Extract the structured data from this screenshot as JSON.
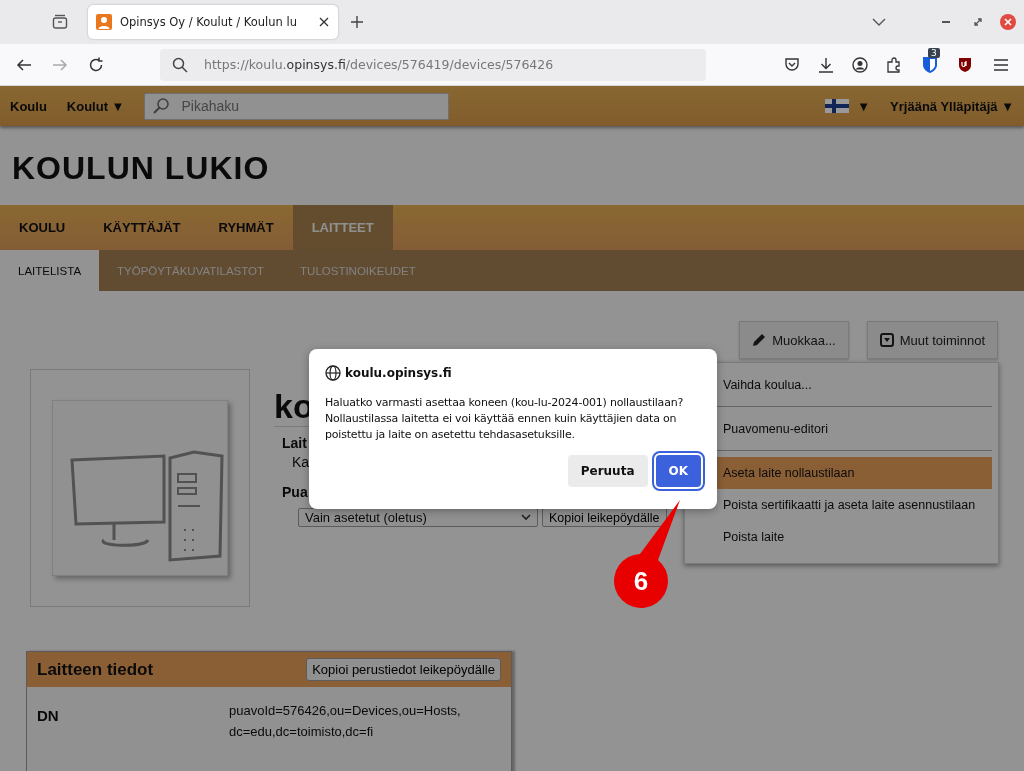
{
  "browser": {
    "tab_title": "Opinsys Oy / Koulut / Koulun lu",
    "url": "https://koulu.**opinsys.fi**/devices/576419/devices/576426",
    "extension_badge": "3"
  },
  "topbar": {
    "items": [
      "Koulu",
      "Koulut ▼"
    ],
    "search": {
      "placeholder": "Pikahaku"
    },
    "language_caret": "▼",
    "user": "Yrjäänä Ylläpitäjä ▼"
  },
  "school_title": "KOULUN LUKIO",
  "main_tabs": [
    {
      "label": "KOULU",
      "selected": false
    },
    {
      "label": "KÄYTTÄJÄT",
      "selected": false
    },
    {
      "label": "RYHMÄT",
      "selected": false
    },
    {
      "label": "LAITTEET",
      "selected": true
    }
  ],
  "sub_tabs": [
    {
      "label": "LAITELISTA",
      "selected": true
    },
    {
      "label": "TYÖPÖYTÄKUVATILASTOT",
      "selected": false
    },
    {
      "label": "TULOSTINOIKEUDET",
      "selected": false
    }
  ],
  "actions": [
    "Muokkaa...",
    "Muut toiminnot"
  ],
  "menu": [
    {
      "label": "Vaihda koulua...",
      "highlighted": false,
      "divider_after": true
    },
    {
      "label": "Puavomenu-editori",
      "highlighted": false,
      "divider_after": true
    },
    {
      "label": "Aseta laite nollaustilaan",
      "highlighted": true,
      "divider_after": false
    },
    {
      "label": "Poista sertifikaatti ja aseta laite asennustilaan",
      "highlighted": false,
      "divider_after": false
    },
    {
      "label": "Poista laite",
      "highlighted": false,
      "divider_after": false
    }
  ],
  "device": {
    "heading": "ko",
    "label_1": "Lait",
    "value_1": "Ka",
    "label_2": "Pua",
    "select": "Vain asetetut (oletus)",
    "copy_button": "Kopioi leikepöydälle"
  },
  "info_card": {
    "title": "Laitteen tiedot",
    "copy_button": "Kopioi perustiedot leikepöydälle",
    "rows": [
      {
        "label": "DN",
        "value": "puavoId=576426,ou=Devices,ou=Hosts, dc=edu,dc=toimisto,dc=fi"
      }
    ]
  },
  "dialog": {
    "origin": "koulu.opinsys.fi",
    "message": "Haluatko varmasti asettaa koneen (kou-lu-2024-001) nollaustilaan? Nollaustilassa laitetta ei voi käyttää ennen kuin käyttäjien data on poistettu ja laite on asetettu tehdasasetuksille.",
    "buttons": [
      {
        "label": "Peruuta",
        "kind": "secondary",
        "focused": false
      },
      {
        "label": "OK",
        "kind": "primary",
        "focused": true
      }
    ]
  },
  "callout": "6"
}
